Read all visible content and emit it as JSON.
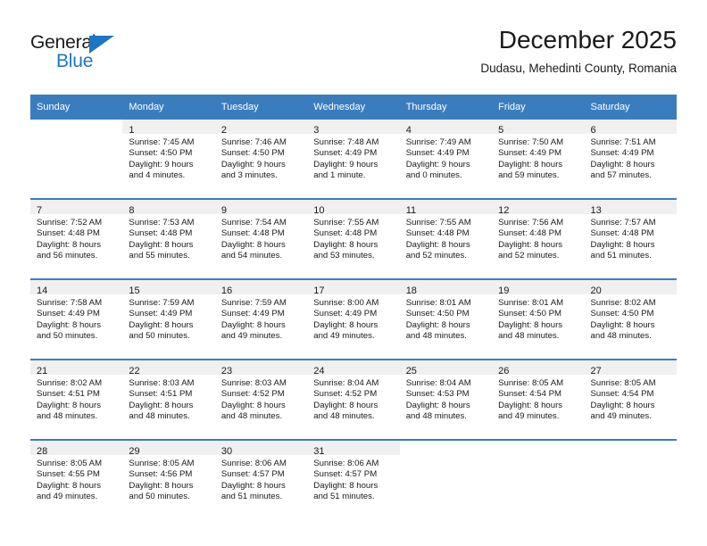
{
  "logo": {
    "primary_text": "General",
    "secondary_text": "Blue",
    "primary_color": "#1a1a1a",
    "accent_color": "#1d76c4"
  },
  "header": {
    "title": "December 2025",
    "subtitle": "Dudasu, Mehedinti County, Romania"
  },
  "theme": {
    "header_bg": "#3a7dbf",
    "header_text": "#ffffff",
    "daynum_band_bg": "#f0f0f0",
    "cell_bg": "#ffffff",
    "row_divider": "#3a7dbf"
  },
  "calendar": {
    "weekday_headers": [
      "Sunday",
      "Monday",
      "Tuesday",
      "Wednesday",
      "Thursday",
      "Friday",
      "Saturday"
    ],
    "weeks": [
      [
        {
          "day": "",
          "lines": []
        },
        {
          "day": "1",
          "lines": [
            "Sunrise: 7:45 AM",
            "Sunset: 4:50 PM",
            "Daylight: 9 hours",
            "and 4 minutes."
          ]
        },
        {
          "day": "2",
          "lines": [
            "Sunrise: 7:46 AM",
            "Sunset: 4:50 PM",
            "Daylight: 9 hours",
            "and 3 minutes."
          ]
        },
        {
          "day": "3",
          "lines": [
            "Sunrise: 7:48 AM",
            "Sunset: 4:49 PM",
            "Daylight: 9 hours",
            "and 1 minute."
          ]
        },
        {
          "day": "4",
          "lines": [
            "Sunrise: 7:49 AM",
            "Sunset: 4:49 PM",
            "Daylight: 9 hours",
            "and 0 minutes."
          ]
        },
        {
          "day": "5",
          "lines": [
            "Sunrise: 7:50 AM",
            "Sunset: 4:49 PM",
            "Daylight: 8 hours",
            "and 59 minutes."
          ]
        },
        {
          "day": "6",
          "lines": [
            "Sunrise: 7:51 AM",
            "Sunset: 4:49 PM",
            "Daylight: 8 hours",
            "and 57 minutes."
          ]
        }
      ],
      [
        {
          "day": "7",
          "lines": [
            "Sunrise: 7:52 AM",
            "Sunset: 4:48 PM",
            "Daylight: 8 hours",
            "and 56 minutes."
          ]
        },
        {
          "day": "8",
          "lines": [
            "Sunrise: 7:53 AM",
            "Sunset: 4:48 PM",
            "Daylight: 8 hours",
            "and 55 minutes."
          ]
        },
        {
          "day": "9",
          "lines": [
            "Sunrise: 7:54 AM",
            "Sunset: 4:48 PM",
            "Daylight: 8 hours",
            "and 54 minutes."
          ]
        },
        {
          "day": "10",
          "lines": [
            "Sunrise: 7:55 AM",
            "Sunset: 4:48 PM",
            "Daylight: 8 hours",
            "and 53 minutes."
          ]
        },
        {
          "day": "11",
          "lines": [
            "Sunrise: 7:55 AM",
            "Sunset: 4:48 PM",
            "Daylight: 8 hours",
            "and 52 minutes."
          ]
        },
        {
          "day": "12",
          "lines": [
            "Sunrise: 7:56 AM",
            "Sunset: 4:48 PM",
            "Daylight: 8 hours",
            "and 52 minutes."
          ]
        },
        {
          "day": "13",
          "lines": [
            "Sunrise: 7:57 AM",
            "Sunset: 4:48 PM",
            "Daylight: 8 hours",
            "and 51 minutes."
          ]
        }
      ],
      [
        {
          "day": "14",
          "lines": [
            "Sunrise: 7:58 AM",
            "Sunset: 4:49 PM",
            "Daylight: 8 hours",
            "and 50 minutes."
          ]
        },
        {
          "day": "15",
          "lines": [
            "Sunrise: 7:59 AM",
            "Sunset: 4:49 PM",
            "Daylight: 8 hours",
            "and 50 minutes."
          ]
        },
        {
          "day": "16",
          "lines": [
            "Sunrise: 7:59 AM",
            "Sunset: 4:49 PM",
            "Daylight: 8 hours",
            "and 49 minutes."
          ]
        },
        {
          "day": "17",
          "lines": [
            "Sunrise: 8:00 AM",
            "Sunset: 4:49 PM",
            "Daylight: 8 hours",
            "and 49 minutes."
          ]
        },
        {
          "day": "18",
          "lines": [
            "Sunrise: 8:01 AM",
            "Sunset: 4:50 PM",
            "Daylight: 8 hours",
            "and 48 minutes."
          ]
        },
        {
          "day": "19",
          "lines": [
            "Sunrise: 8:01 AM",
            "Sunset: 4:50 PM",
            "Daylight: 8 hours",
            "and 48 minutes."
          ]
        },
        {
          "day": "20",
          "lines": [
            "Sunrise: 8:02 AM",
            "Sunset: 4:50 PM",
            "Daylight: 8 hours",
            "and 48 minutes."
          ]
        }
      ],
      [
        {
          "day": "21",
          "lines": [
            "Sunrise: 8:02 AM",
            "Sunset: 4:51 PM",
            "Daylight: 8 hours",
            "and 48 minutes."
          ]
        },
        {
          "day": "22",
          "lines": [
            "Sunrise: 8:03 AM",
            "Sunset: 4:51 PM",
            "Daylight: 8 hours",
            "and 48 minutes."
          ]
        },
        {
          "day": "23",
          "lines": [
            "Sunrise: 8:03 AM",
            "Sunset: 4:52 PM",
            "Daylight: 8 hours",
            "and 48 minutes."
          ]
        },
        {
          "day": "24",
          "lines": [
            "Sunrise: 8:04 AM",
            "Sunset: 4:52 PM",
            "Daylight: 8 hours",
            "and 48 minutes."
          ]
        },
        {
          "day": "25",
          "lines": [
            "Sunrise: 8:04 AM",
            "Sunset: 4:53 PM",
            "Daylight: 8 hours",
            "and 48 minutes."
          ]
        },
        {
          "day": "26",
          "lines": [
            "Sunrise: 8:05 AM",
            "Sunset: 4:54 PM",
            "Daylight: 8 hours",
            "and 49 minutes."
          ]
        },
        {
          "day": "27",
          "lines": [
            "Sunrise: 8:05 AM",
            "Sunset: 4:54 PM",
            "Daylight: 8 hours",
            "and 49 minutes."
          ]
        }
      ],
      [
        {
          "day": "28",
          "lines": [
            "Sunrise: 8:05 AM",
            "Sunset: 4:55 PM",
            "Daylight: 8 hours",
            "and 49 minutes."
          ]
        },
        {
          "day": "29",
          "lines": [
            "Sunrise: 8:05 AM",
            "Sunset: 4:56 PM",
            "Daylight: 8 hours",
            "and 50 minutes."
          ]
        },
        {
          "day": "30",
          "lines": [
            "Sunrise: 8:06 AM",
            "Sunset: 4:57 PM",
            "Daylight: 8 hours",
            "and 51 minutes."
          ]
        },
        {
          "day": "31",
          "lines": [
            "Sunrise: 8:06 AM",
            "Sunset: 4:57 PM",
            "Daylight: 8 hours",
            "and 51 minutes."
          ]
        },
        {
          "day": "",
          "lines": []
        },
        {
          "day": "",
          "lines": []
        },
        {
          "day": "",
          "lines": []
        }
      ]
    ]
  }
}
